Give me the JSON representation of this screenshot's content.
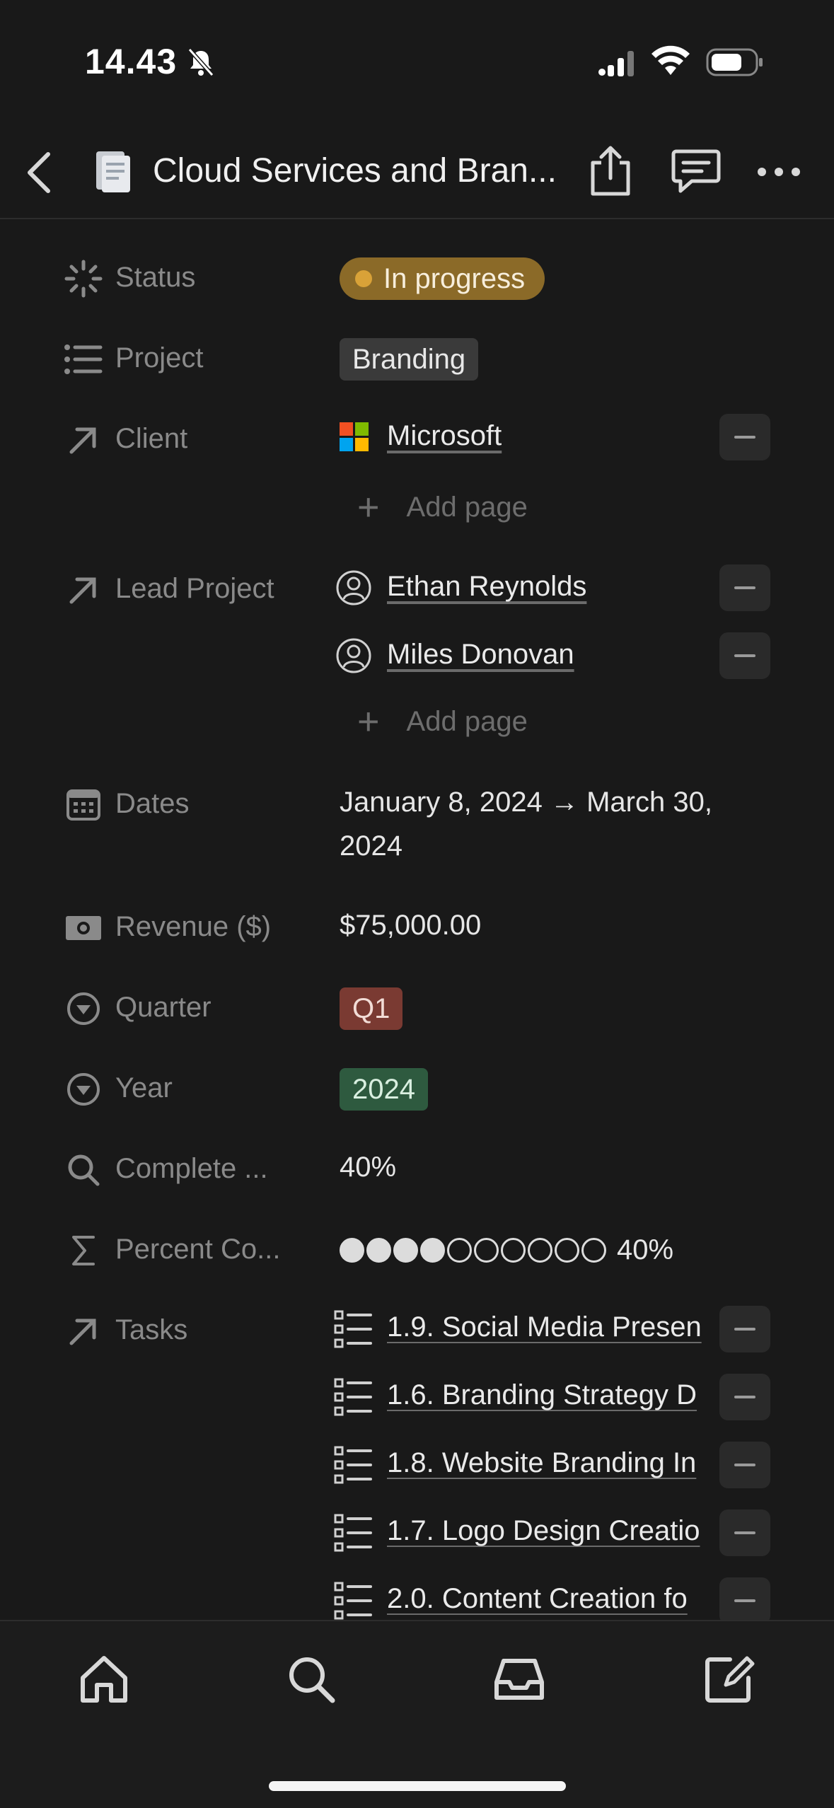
{
  "status_bar": {
    "time": "14.43"
  },
  "header": {
    "title": "Cloud Services and Bran..."
  },
  "properties": {
    "status": {
      "label": "Status",
      "value": "In progress",
      "color": "#8b6a28",
      "dot_color": "#d9a238"
    },
    "project": {
      "label": "Project",
      "value": "Branding",
      "color": "#3a3a3a"
    },
    "client": {
      "label": "Client",
      "value": "Microsoft",
      "add_label": "Add page"
    },
    "lead_project": {
      "label": "Lead Project",
      "people": [
        "Ethan Reynolds",
        "Miles Donovan"
      ],
      "add_label": "Add page"
    },
    "dates": {
      "label": "Dates",
      "line1": "January 8, 2024 → March 30,",
      "line2": "2024"
    },
    "revenue": {
      "label": "Revenue ($)",
      "value": "$75,000.00"
    },
    "quarter": {
      "label": "Quarter",
      "value": "Q1",
      "color": "#7a3a32"
    },
    "year": {
      "label": "Year",
      "value": "2024",
      "color": "#2e5a3f"
    },
    "complete": {
      "label": "Complete ...",
      "value": "40%"
    },
    "percent": {
      "label": "Percent Co...",
      "value_text": "40%",
      "filled_fraction": 0.4
    },
    "tasks": {
      "label": "Tasks",
      "items": [
        "1.9. Social Media Presen",
        "1.6. Branding Strategy D",
        "1.8. Website Branding In",
        "1.7. Logo Design Creatio",
        "2.0. Content Creation fo"
      ]
    }
  },
  "bottom_nav": [
    "home-icon",
    "search-icon",
    "inbox-icon",
    "compose-icon"
  ]
}
